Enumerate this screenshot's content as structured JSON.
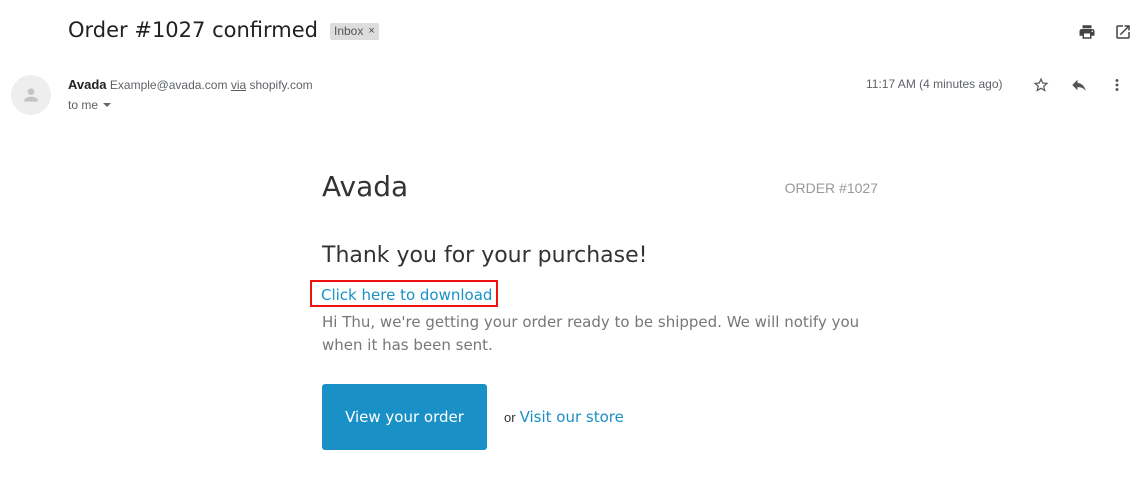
{
  "header": {
    "subject": "Order #1027 confirmed",
    "label": "Inbox",
    "label_remove": "×"
  },
  "message": {
    "sender_name": "Avada",
    "sender_email": "Example@avada.com",
    "via": "via",
    "via_domain": "shopify.com",
    "to": "to me",
    "time": "11:17 AM (4 minutes ago)"
  },
  "email": {
    "store_name": "Avada",
    "order_number": "ORDER #1027",
    "thanks": "Thank you for your purchase!",
    "download_link": "Click here to download",
    "description": "Hi Thu, we're getting your order ready to be shipped. We will notify you when it has been sent.",
    "view_order_button": "View your order",
    "or_text": "or",
    "visit_store_link": "Visit our store"
  },
  "colors": {
    "link": "#1990c6",
    "button_bg": "#1990c6",
    "highlight_border": "#e11111"
  },
  "icons": [
    "print-icon",
    "open-in-new-icon",
    "star-icon",
    "reply-icon",
    "more-vert-icon",
    "avatar-icon"
  ]
}
